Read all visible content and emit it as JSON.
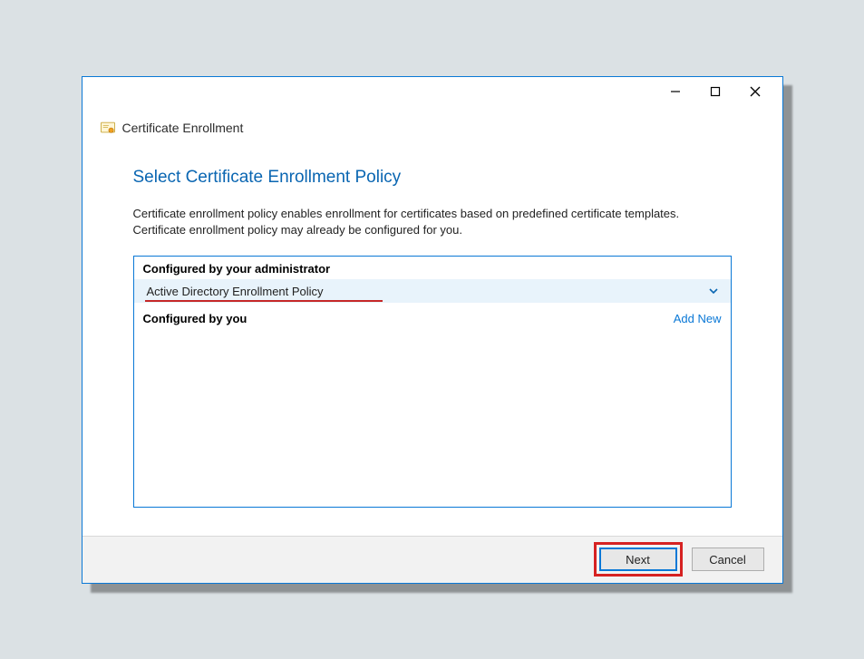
{
  "window": {
    "header_title": "Certificate Enrollment"
  },
  "page": {
    "heading": "Select Certificate Enrollment Policy",
    "description": "Certificate enrollment policy enables enrollment for certificates based on predefined certificate templates. Certificate enrollment policy may already be configured for you."
  },
  "sections": {
    "admin_label": "Configured by your administrator",
    "admin_policy": "Active Directory Enrollment Policy",
    "user_label": "Configured by you",
    "add_new": "Add New"
  },
  "buttons": {
    "next": "Next",
    "cancel": "Cancel"
  },
  "colors": {
    "accent": "#0a78d6",
    "highlight_red": "#d62222"
  }
}
